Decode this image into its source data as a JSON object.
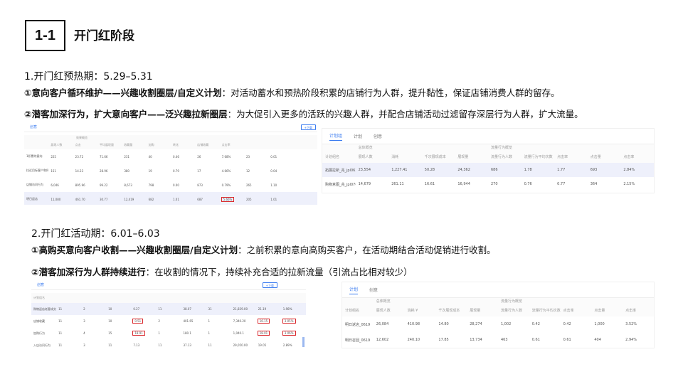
{
  "header": {
    "section_no": "1-1",
    "title": "开门红阶段"
  },
  "phase1": {
    "heading": "1.开门红预热期：5.29–5.31",
    "items": [
      {
        "bold": "①意向客户循环维护——兴趣收割圈层/自定义计划",
        "text": "：对活动蓄水和预热阶段积累的店铺行为人群，提升黏性，保证店铺消费人群的留存。"
      },
      {
        "bold": "②潜客加深行为，扩大意向客户——泛兴趣拉新圈层",
        "text": "：为大促引入更多的活跃的兴趣人群，并配合店铺活动过滤留存深层行为人群，扩大流量。"
      }
    ]
  },
  "phase2": {
    "heading": "2.开门红活动期：6.01–6.03",
    "items": [
      {
        "bold": "①高购买意向客户收割——兴趣收割圈层/自定义计划",
        "text": "：之前积累的意向高购买客户，在活动期结合活动促销进行收割。"
      },
      {
        "bold": "②潜客加深行为人群持续进行",
        "text": "：在收割的情况下，持续补充合适的拉新流量（引流占比相对较少）"
      }
    ]
  },
  "shot1": {
    "tab": "创意",
    "button": "+下载",
    "group_label": "效果概览",
    "headers": [
      "",
      "展现人数",
      "点击",
      "平均展现量",
      "收藏量",
      "加购",
      "转化",
      "店铺收藏",
      "点击率",
      "",
      "",
      ""
    ],
    "rows": [
      [
        "1积累的意向",
        "225",
        "23.72",
        "71.66",
        "231",
        "40",
        "0.46",
        "26",
        "7.68%",
        "23",
        "0.01"
      ],
      [
        "拉近目标客户和所属购买意向群",
        "151",
        "14.23",
        "28.96",
        "380",
        "19",
        "0.79",
        "17",
        "4.66%",
        "12",
        "0.04"
      ],
      [
        "店铺访问行为",
        "6,046",
        "895.96",
        "99.22",
        "8,673",
        "798",
        "0.00",
        "873",
        "0.79%",
        "265",
        "1.10"
      ],
      [
        "明日返店",
        "11,080",
        "461.70",
        "30.77",
        "12,419",
        "682",
        "1.01",
        "687",
        "5.66%",
        "205",
        "1.01"
      ]
    ],
    "boxed_value": "5.66%"
  },
  "shot2": {
    "tabs": [
      "计划组",
      "计划",
      "创意"
    ],
    "group_left": "总体概览",
    "group_right": "流量行为概览",
    "headers": [
      "计划组名",
      "展现人数",
      "消耗",
      "千次展现成本",
      "展现量",
      "流量行为人数",
      "流量行为平均次数",
      "点击率",
      "点击量",
      "点击率"
    ],
    "rows": [
      [
        "拓展拉新_兆_jpl0630",
        "23,554",
        "1,227.41",
        "50.28",
        "24,362",
        "686",
        "1.78",
        "1.77",
        "693",
        "2.84%"
      ],
      [
        "购物意图_兆_jpl0701",
        "14,679",
        "261.11",
        "16.61",
        "16,944",
        "270",
        "0.76",
        "0.77",
        "364",
        "2.15%"
      ]
    ]
  },
  "shot3": {
    "tab": "创意",
    "button": "+下载",
    "headers": [
      "计划组名",
      "",
      "",
      "",
      "",
      "",
      "",
      "",
      "",
      "",
      "",
      ""
    ],
    "rows": [
      [
        "购物返店老客成交转化",
        "11",
        "2",
        "10",
        "0.27",
        "11",
        "38.07",
        "31",
        "21,839.00",
        "21.19",
        "1.98%"
      ],
      [
        "店铺收藏",
        "11",
        "3",
        "10",
        "0.51",
        "2",
        "401.65",
        "1",
        "7,340.20",
        "16.15",
        "3.05%"
      ],
      [
        "加购行为",
        "11",
        "4",
        "15",
        "18.91",
        "1",
        "180.1",
        "1",
        "1,040.1",
        "18.01",
        "3.06%"
      ],
      [
        "入店访问行为",
        "11",
        "3",
        "11",
        "7.13",
        "11",
        "37.13",
        "11",
        "29,050.00",
        "19.05",
        "2.89%"
      ]
    ]
  },
  "shot4": {
    "tabs": [
      "计划",
      "创意"
    ],
    "group_left": "总体概览",
    "group_right": "流量行为概览",
    "headers": [
      "计划组名",
      "展现人数",
      "消耗 ¥",
      "千次展现成本",
      "展现量",
      "流量行为人数",
      "流量行为平均次数",
      "点击率",
      "点击量",
      "点击率"
    ],
    "rows": [
      [
        "明日返店_0619",
        "26,084",
        "410.98",
        "14.80",
        "28,274",
        "1,002",
        "0.42",
        "0.42",
        "1,000",
        "3.52%"
      ],
      [
        "明日召回_0619",
        "12,602",
        "240.10",
        "17.85",
        "13,734",
        "463",
        "0.61",
        "0.61",
        "404",
        "2.94%"
      ]
    ]
  }
}
